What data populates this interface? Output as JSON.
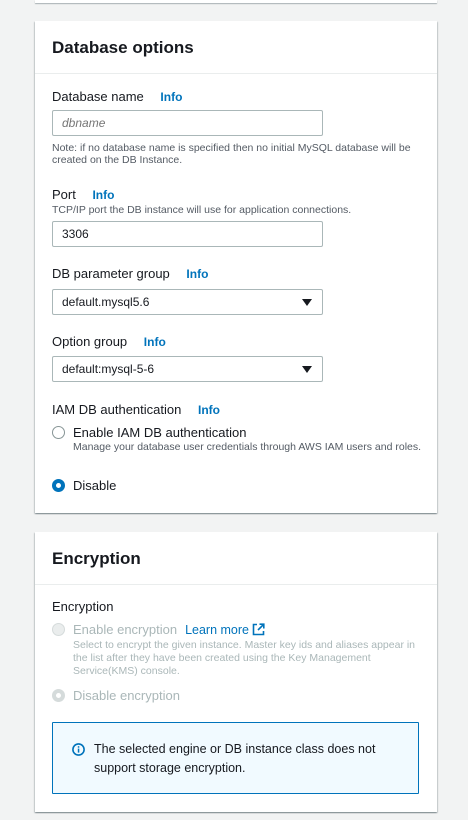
{
  "database_options": {
    "title": "Database options",
    "db_name": {
      "label": "Database name",
      "info": "Info",
      "placeholder": "dbname",
      "hint": "Note: if no database name is specified then no initial MySQL database will be created on the DB Instance."
    },
    "port": {
      "label": "Port",
      "info": "Info",
      "hint": "TCP/IP port the DB instance will use for application connections.",
      "value": "3306"
    },
    "param_group": {
      "label": "DB parameter group",
      "info": "Info",
      "value": "default.mysql5.6"
    },
    "option_group": {
      "label": "Option group",
      "info": "Info",
      "value": "default:mysql-5-6"
    },
    "iam": {
      "label": "IAM DB authentication",
      "info": "Info",
      "enable_label": "Enable IAM DB authentication",
      "enable_desc": "Manage your database user credentials through AWS IAM users and roles.",
      "disable_label": "Disable",
      "selected": "Disable"
    }
  },
  "encryption": {
    "title": "Encryption",
    "field_label": "Encryption",
    "enable_label": "Enable encryption",
    "learn_more": "Learn more",
    "enable_desc": "Select to encrypt the given instance. Master key ids and aliases appear in the list after they have been created using the Key Management Service(KMS) console.",
    "disable_label": "Disable encryption",
    "alert_text": "The selected engine or DB instance class does not support storage encryption."
  },
  "colors": {
    "accent": "#0073bb",
    "background": "#f2f3f3"
  }
}
